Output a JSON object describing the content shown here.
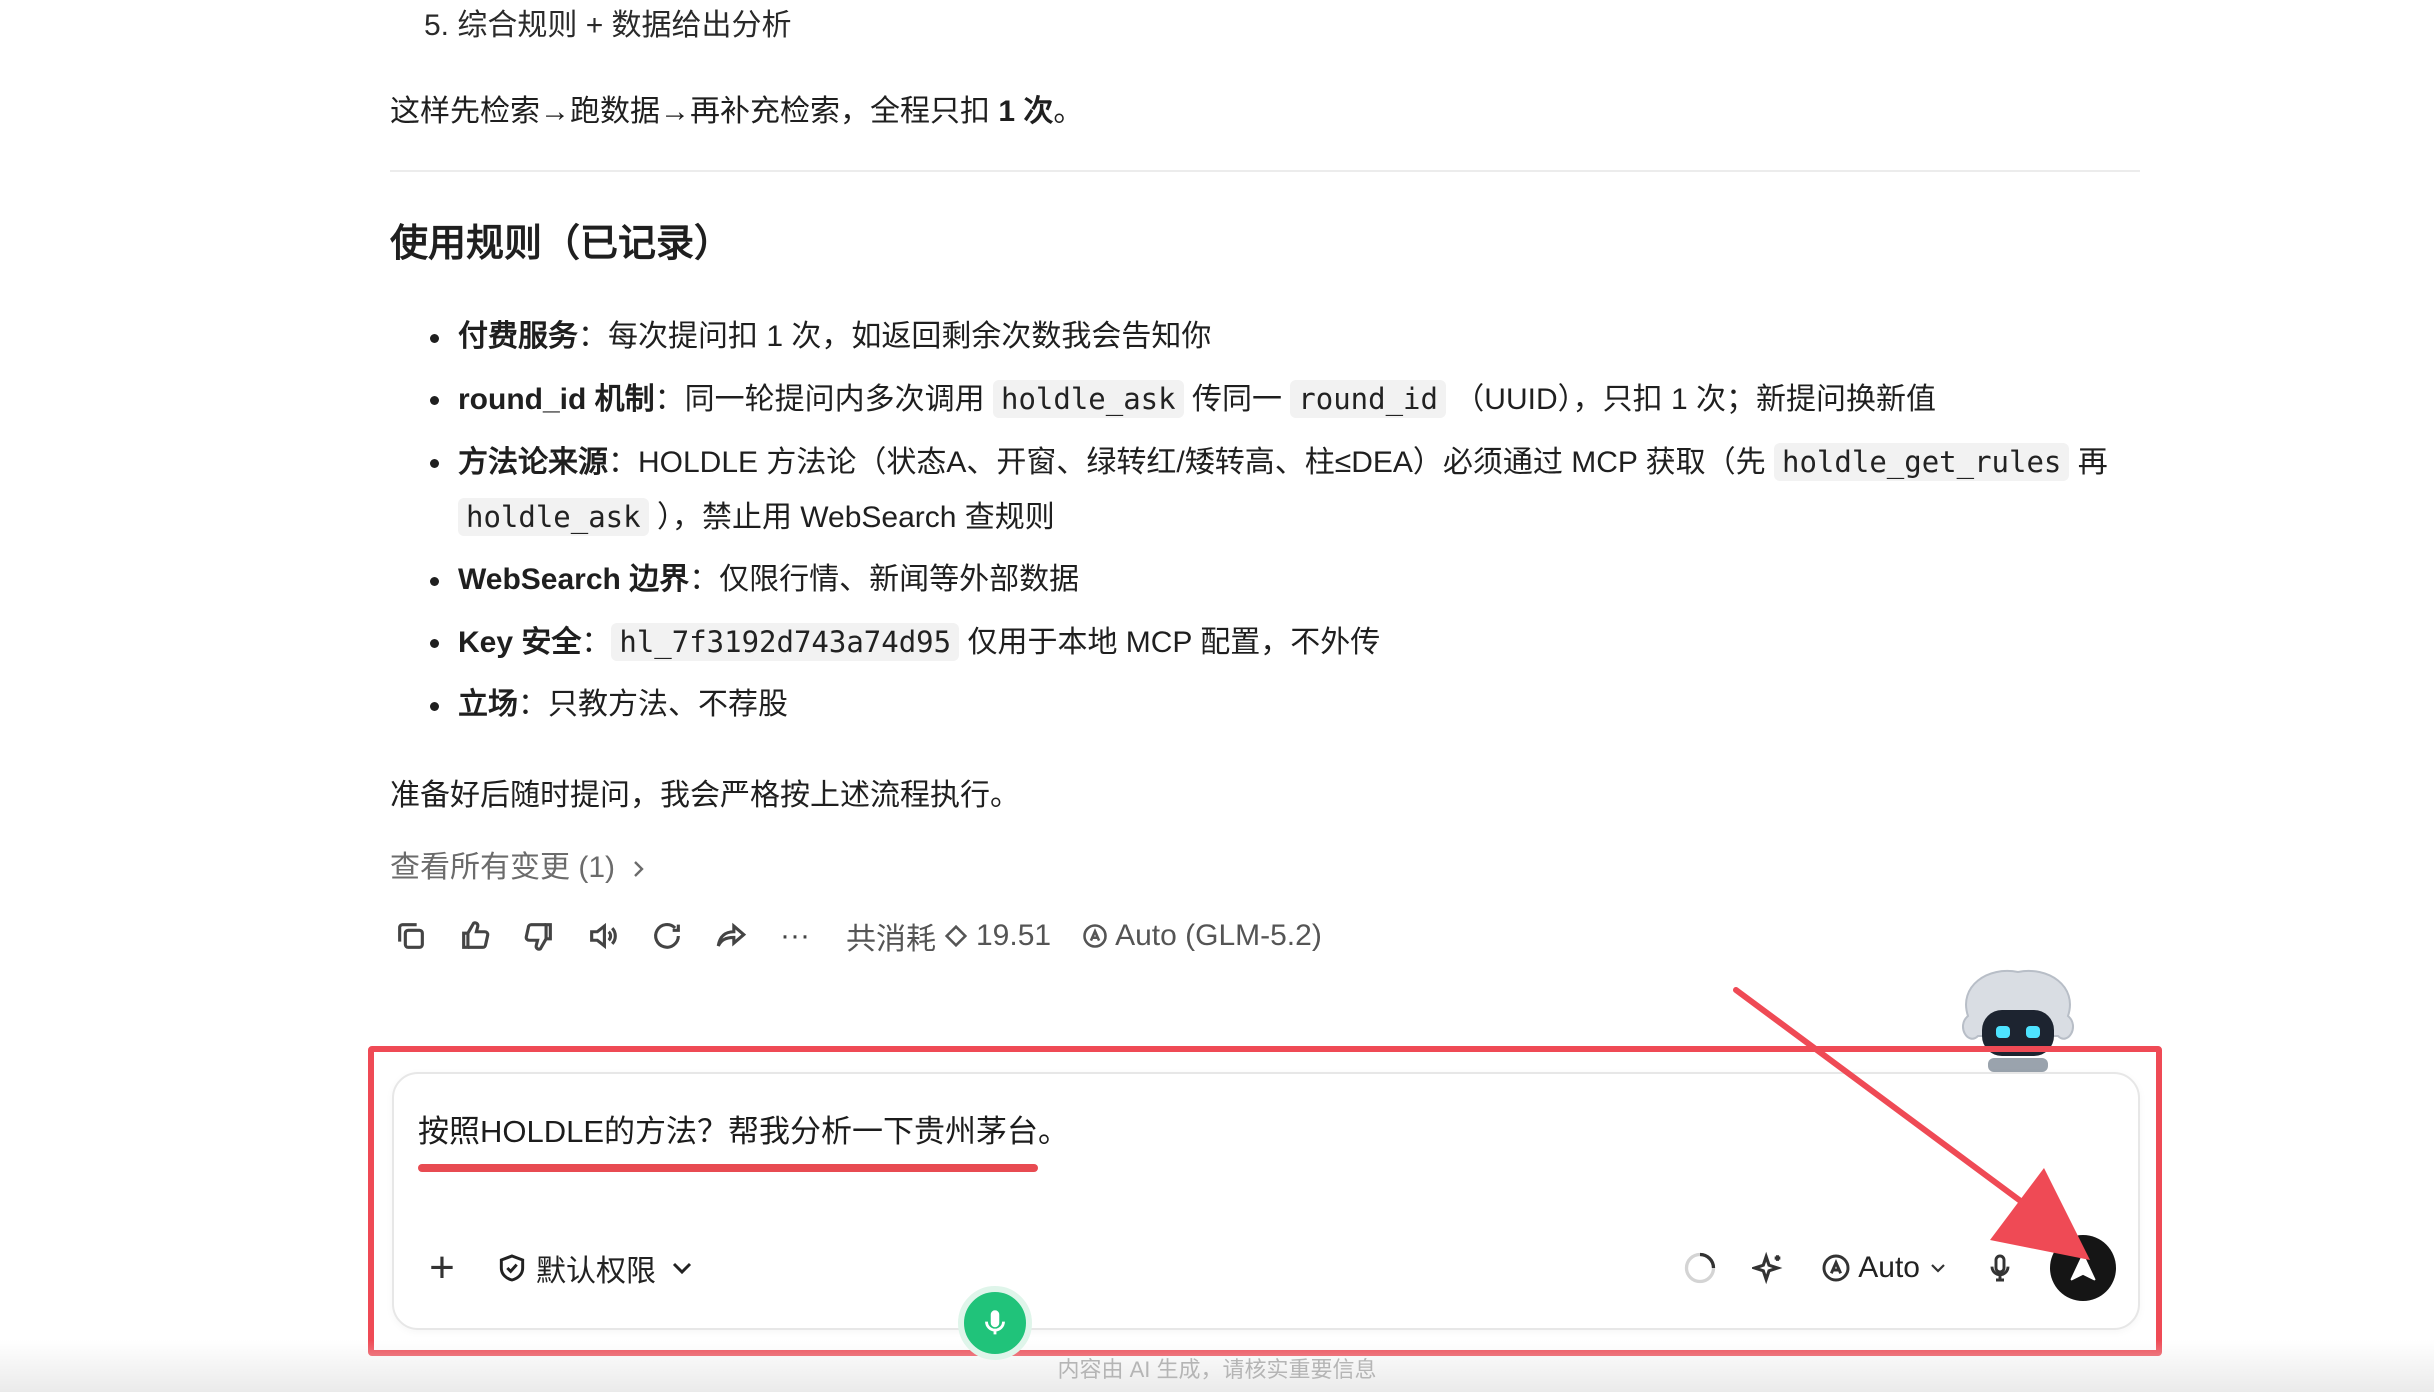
{
  "message": {
    "step5": "5. 综合规则 + 数据给出分析",
    "summary_pre": "这样先检索→跑数据→再补充检索，全程只扣 ",
    "summary_bold": "1 次",
    "summary_post": "。",
    "rules_heading": "使用规则（已记录）",
    "rules": [
      {
        "label": "付费服务",
        "text": "：每次提问扣 1 次，如返回剩余次数我会告知你"
      },
      {
        "label": "round_id 机制",
        "t1": "：同一轮提问内多次调用 ",
        "c1": "holdle_ask",
        "t2": " 传同一 ",
        "c2": "round_id",
        "t3": " （UUID），只扣 1 次；新提问换新值"
      },
      {
        "label": "方法论来源",
        "t1": "：HOLDLE 方法论（状态A、开窗、绿转红/矮转高、柱≤DEA）必须通过 MCP 获取（先 ",
        "c1": "holdle_get_rules",
        "t2": " 再 ",
        "c2": "holdle_ask",
        "t3": " ），禁止用 WebSearch 查规则"
      },
      {
        "label": "WebSearch 边界",
        "text": "：仅限行情、新闻等外部数据"
      },
      {
        "label": "Key 安全",
        "t1": "：",
        "c1": "hl_7f3192d743a74d95",
        "t2": " 仅用于本地 MCP 配置，不外传"
      },
      {
        "label": "立场",
        "text": "：只教方法、不荐股"
      }
    ],
    "closing": "准备好后随时提问，我会严格按上述流程执行。",
    "changes_link": "查看所有变更 (1)",
    "cost_label": "共消耗",
    "cost_value": "19.51",
    "model_label": "Auto (GLM-5.2)"
  },
  "icons": {
    "toolbar": [
      "copy-icon",
      "thumbs-up-icon",
      "thumbs-down-icon",
      "speaker-icon",
      "regenerate-icon",
      "share-icon",
      "more-icon"
    ],
    "more_glyph": "···"
  },
  "composer": {
    "input_value": "按照HOLDLE的方法？帮我分析一下贵州茅台。",
    "permission_label": "默认权限",
    "model_selector": "Auto",
    "send_color": "#151515",
    "highlight_color": "#ef4a55"
  },
  "footer": {
    "disclaimer": "内容由 AI 生成，请核实重要信息"
  }
}
